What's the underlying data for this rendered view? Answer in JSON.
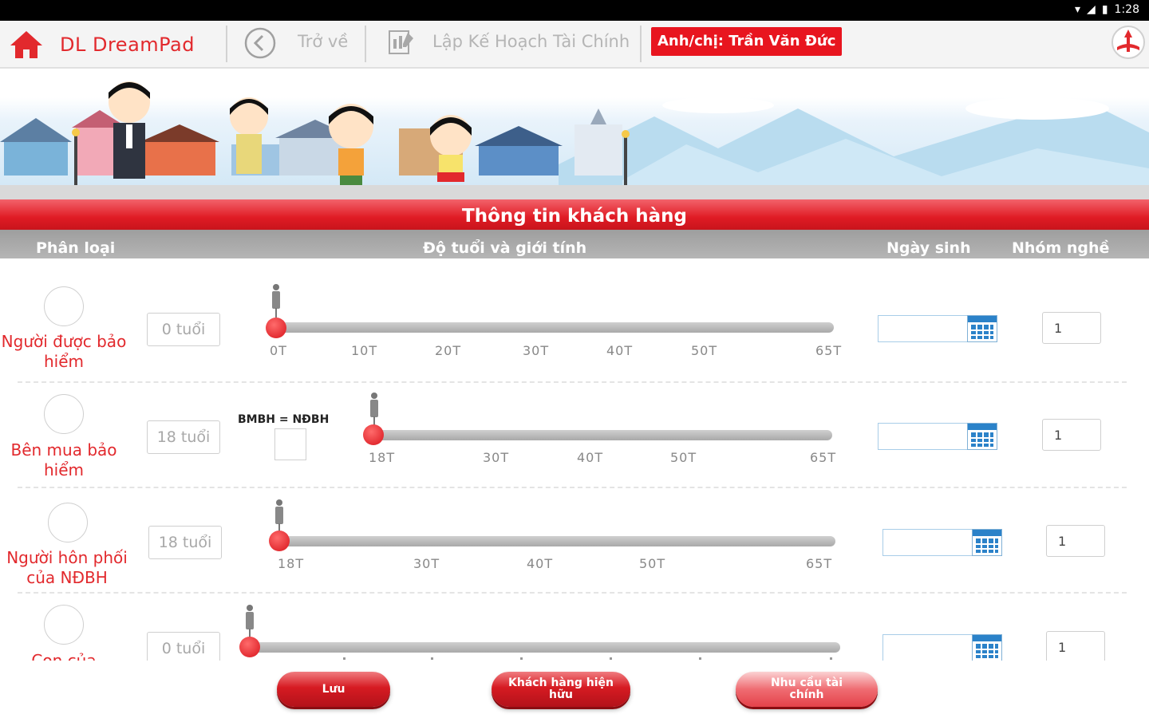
{
  "status": {
    "time": "1:28"
  },
  "nav": {
    "brand": "DL DreamPad",
    "back_label": "Trở về",
    "plan_label": "Lập Kế Hoạch Tài Chính",
    "customer_label": "Anh/chị: Trần Văn Đức"
  },
  "section_title": "Thông tin khách hàng",
  "columns": {
    "category": "Phân loại",
    "age_gender": "Độ tuổi và giới tính",
    "dob": "Ngày sinh",
    "occupation": "Nhóm nghề"
  },
  "rows": [
    {
      "label": "Người được bảo hiểm",
      "age": "0 tuổi",
      "ticks": [
        "0T",
        "10T",
        "20T",
        "30T",
        "40T",
        "50T",
        "65T"
      ],
      "occupation": "1"
    },
    {
      "label": "Bên mua bảo hiểm",
      "age": "18 tuổi",
      "checkbox_label": "BMBH = NĐBH",
      "ticks": [
        "18T",
        "30T",
        "40T",
        "50T",
        "65T"
      ],
      "occupation": "1"
    },
    {
      "label": "Người hôn phối của NĐBH",
      "age": "18 tuổi",
      "ticks": [
        "18T",
        "30T",
        "40T",
        "50T",
        "65T"
      ],
      "occupation": "1"
    },
    {
      "label": "Con của",
      "age": "0 tuổi",
      "ticks": [],
      "occupation": "1"
    }
  ],
  "buttons": {
    "save": "Lưu",
    "existing_customer": "Khách hàng hiện hữu",
    "financial_needs": "Nhu cầu tài chính"
  }
}
